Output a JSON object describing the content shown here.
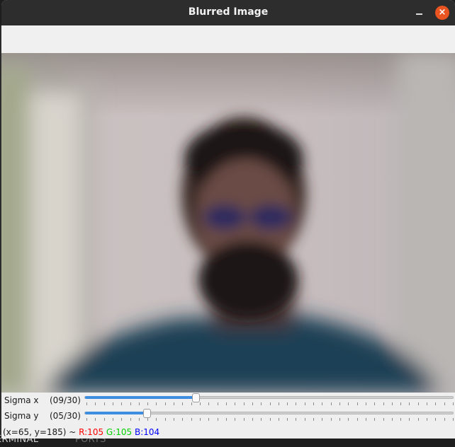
{
  "window": {
    "title": "Blurred Image"
  },
  "background": {
    "left_text": "ERMINAL",
    "right_text": "PORTS"
  },
  "trackbars": [
    {
      "label": "Sigma x",
      "value_text": "(09/30)",
      "value": 9,
      "max": 30
    },
    {
      "label": "Sigma y",
      "value_text": "(05/30)",
      "value": 5,
      "max": 30
    }
  ],
  "status": {
    "coords": "(x=65, y=185) ~ ",
    "r": "R:105",
    "g": "G:105",
    "b": "B:104",
    "colors": {
      "r": "#ff0000",
      "g": "#00d000",
      "b": "#0000ff"
    }
  },
  "colors": {
    "accent": "#e95420",
    "slider_fill": "#3d8ee0",
    "titlebar": "#2d2d2d"
  },
  "icons": {
    "minimize": "minimize-icon",
    "close": "close-icon"
  }
}
